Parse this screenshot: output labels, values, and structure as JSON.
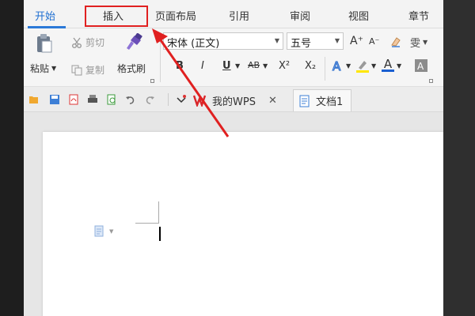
{
  "menu": {
    "tabs": [
      {
        "label": "开始"
      },
      {
        "label": "插入"
      },
      {
        "label": "页面布局"
      },
      {
        "label": "引用"
      },
      {
        "label": "审阅"
      },
      {
        "label": "视图"
      },
      {
        "label": "章节"
      }
    ],
    "active_tab": "开始",
    "highlighted_tab": "插入"
  },
  "ribbon": {
    "paste_label": "粘贴",
    "cut_label": "剪切",
    "copy_label": "复制",
    "format_painter_label": "格式刷",
    "font_name": "宋体 (正文)",
    "font_size": "五号",
    "bold": "B",
    "italic": "I",
    "underline": "U",
    "strike": "AB",
    "superscript": "X²",
    "subscript": "X₂",
    "font_color_letter": "A",
    "grow_font": "A⁺",
    "shrink_font": "A⁻",
    "phonetic_label": "雯"
  },
  "doc_tabs": [
    {
      "label": "我的WPS"
    },
    {
      "label": "文档1"
    }
  ],
  "colors": {
    "active_tab": "#1f6fd1",
    "highlight_box": "#e02020",
    "arrow": "#e02020",
    "wps_logo": "#d9262a"
  }
}
